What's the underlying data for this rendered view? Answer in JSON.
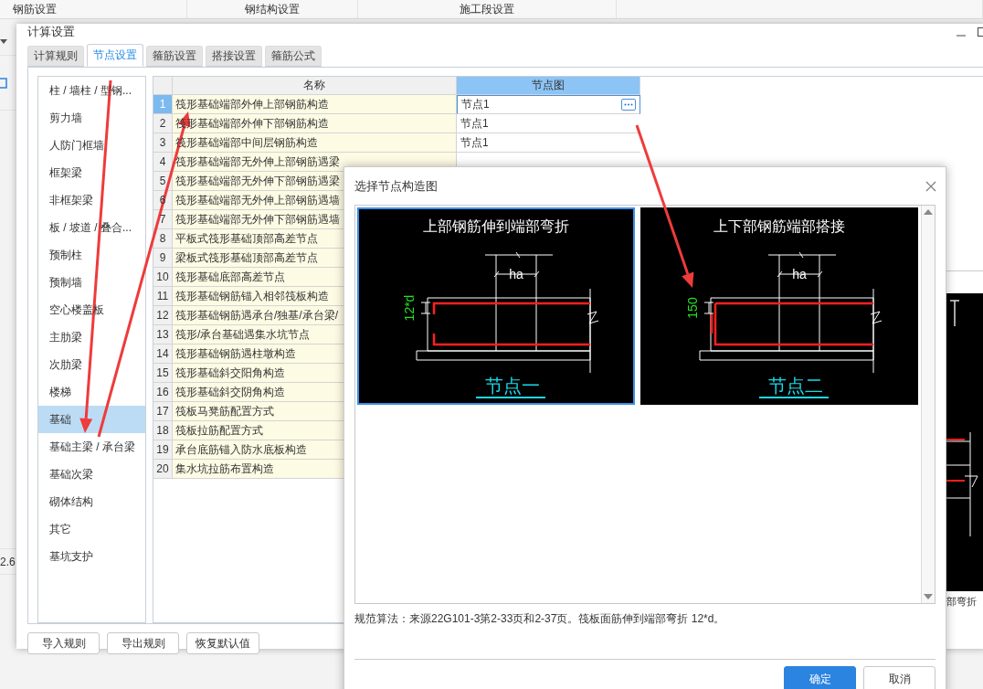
{
  "background_app": {
    "tabs": [
      "钢筋设置",
      "钢结构设置",
      "施工段设置"
    ],
    "side_value": "2.6",
    "cad_caption": "部弯折"
  },
  "settings_dialog": {
    "title": "计算设置",
    "tabs": [
      {
        "label": "计算规则",
        "selected": false
      },
      {
        "label": "节点设置",
        "selected": true
      },
      {
        "label": "箍筋设置",
        "selected": false
      },
      {
        "label": "搭接设置",
        "selected": false
      },
      {
        "label": "箍筋公式",
        "selected": false
      }
    ],
    "categories": [
      {
        "label": "柱 / 墙柱 / 型钢...",
        "selected": false
      },
      {
        "label": "剪力墙",
        "selected": false
      },
      {
        "label": "人防门框墙",
        "selected": false
      },
      {
        "label": "框架梁",
        "selected": false
      },
      {
        "label": "非框架梁",
        "selected": false
      },
      {
        "label": "板 / 坡道 / 叠合...",
        "selected": false
      },
      {
        "label": "预制柱",
        "selected": false
      },
      {
        "label": "预制墙",
        "selected": false
      },
      {
        "label": "空心楼盖板",
        "selected": false
      },
      {
        "label": "主肋梁",
        "selected": false
      },
      {
        "label": "次肋梁",
        "selected": false
      },
      {
        "label": "楼梯",
        "selected": false
      },
      {
        "label": "基础",
        "selected": true
      },
      {
        "label": "基础主梁 / 承台梁",
        "selected": false
      },
      {
        "label": "基础次梁",
        "selected": false
      },
      {
        "label": "砌体结构",
        "selected": false
      },
      {
        "label": "其它",
        "selected": false
      },
      {
        "label": "基坑支护",
        "selected": false
      }
    ],
    "table": {
      "columns": [
        "名称",
        "节点图"
      ],
      "rows": [
        {
          "index": "1",
          "name": "筏形基础端部外伸上部钢筋构造",
          "node": "节点1",
          "selected": true
        },
        {
          "index": "2",
          "name": "筏形基础端部外伸下部钢筋构造",
          "node": "节点1",
          "selected": false
        },
        {
          "index": "3",
          "name": "筏形基础端部中间层钢筋构造",
          "node": "节点1",
          "selected": false
        },
        {
          "index": "4",
          "name": "筏形基础端部无外伸上部钢筋遇梁",
          "selected": false
        },
        {
          "index": "5",
          "name": "筏形基础端部无外伸下部钢筋遇梁",
          "selected": false
        },
        {
          "index": "6",
          "name": "筏形基础端部无外伸上部钢筋遇墙",
          "selected": false
        },
        {
          "index": "7",
          "name": "筏形基础端部无外伸下部钢筋遇墙",
          "selected": false
        },
        {
          "index": "8",
          "name": "平板式筏形基础顶部高差节点",
          "selected": false
        },
        {
          "index": "9",
          "name": "梁板式筏形基础顶部高差节点",
          "selected": false
        },
        {
          "index": "10",
          "name": "筏形基础底部高差节点",
          "selected": false
        },
        {
          "index": "11",
          "name": "筏形基础钢筋锚入相邻筏板构造",
          "selected": false
        },
        {
          "index": "12",
          "name": "筏形基础钢筋遇承台/独基/承台梁/",
          "selected": false
        },
        {
          "index": "13",
          "name": "筏形/承台基础遇集水坑节点",
          "selected": false
        },
        {
          "index": "14",
          "name": "筏形基础钢筋遇柱墩构造",
          "selected": false
        },
        {
          "index": "15",
          "name": "筏形基础斜交阳角构造",
          "selected": false
        },
        {
          "index": "16",
          "name": "筏形基础斜交阴角构造",
          "selected": false
        },
        {
          "index": "17",
          "name": "筏板马凳筋配置方式",
          "selected": false
        },
        {
          "index": "18",
          "name": "筏板拉筋配置方式",
          "selected": false
        },
        {
          "index": "19",
          "name": "承台底筋锚入防水底板构造",
          "selected": false
        },
        {
          "index": "20",
          "name": "集水坑拉筋布置构造",
          "selected": false
        }
      ]
    },
    "buttons": [
      "导入规则",
      "导出规则",
      "恢复默认值"
    ]
  },
  "node_dialog": {
    "title": "选择节点构造图",
    "options": [
      {
        "kind": "bent",
        "title": "上部钢筋伸到端部弯折",
        "dimension": "12*d",
        "width_label": "ha",
        "caption": "节点一",
        "selected": true
      },
      {
        "kind": "lapped",
        "title": "上下部钢筋端部搭接",
        "dimension": "150",
        "width_label": "ha",
        "caption": "节点二",
        "selected": false
      }
    ],
    "note": "规范算法：来源22G101-3第2-33页和2-37页。筏板面筋伸到端部弯折 12*d。",
    "buttons": [
      {
        "kind": "primary",
        "label": "确定"
      },
      {
        "kind": "secondary",
        "label": "取消"
      }
    ]
  }
}
